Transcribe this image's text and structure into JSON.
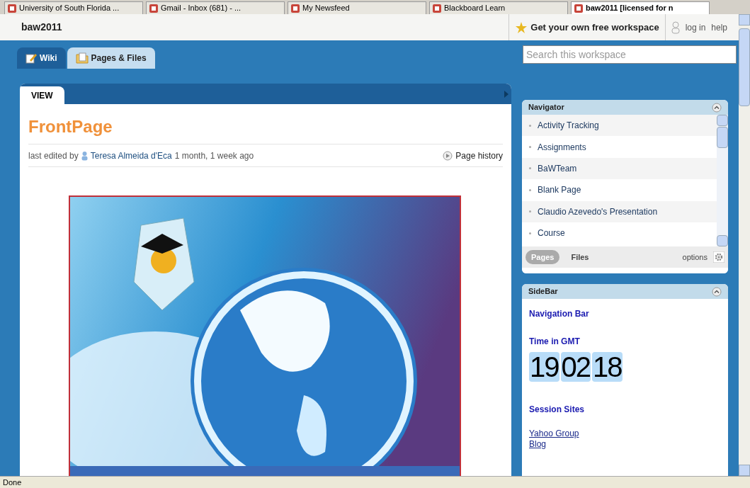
{
  "browser_tabs": [
    {
      "label": "University of South Florida ...",
      "selected": false
    },
    {
      "label": "Gmail - Inbox (681) - ...",
      "selected": false
    },
    {
      "label": "My Newsfeed",
      "selected": false
    },
    {
      "label": "Blackboard Learn",
      "selected": false
    },
    {
      "label": "baw2011 [licensed for n",
      "selected": true
    }
  ],
  "header": {
    "title": "baw2011",
    "promo": "Get your own free workspace",
    "login": "log in",
    "help": "help"
  },
  "tabs": [
    {
      "label": "Wiki",
      "selected": true
    },
    {
      "label": "Pages & Files",
      "selected": false
    }
  ],
  "search": {
    "placeholder": "Search this workspace"
  },
  "page": {
    "view_tab": "VIEW",
    "title": "FrontPage",
    "edited_prefix": "last edited by",
    "author": "Teresa Almeida d'Eca",
    "edited_when": "1 month, 1 week ago",
    "history": "Page history"
  },
  "navigator": {
    "title": "Navigator",
    "items": [
      "Activity Tracking",
      "Assignments",
      "BaWTeam",
      "Blank Page",
      "Claudio Azevedo's Presentation",
      "Course"
    ],
    "tabs": [
      {
        "label": "Pages",
        "selected": true
      },
      {
        "label": "Files",
        "selected": false
      }
    ],
    "options": "options"
  },
  "sidebar": {
    "title": "SideBar",
    "headings": [
      "Navigation Bar",
      "Time in GMT"
    ],
    "clock": [
      "19",
      "02",
      "18"
    ],
    "session": "Session Sites",
    "links": [
      "Yahoo Group",
      "Blog"
    ]
  },
  "status_bar": "Done"
}
